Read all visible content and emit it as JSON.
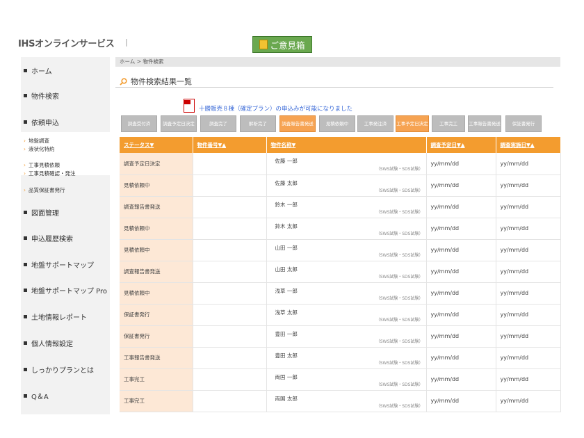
{
  "header": {
    "logo_text": "IHSオンラインサービス",
    "separator": "|",
    "opinion_button": "ご意見箱"
  },
  "sidebar": {
    "items": [
      {
        "label": "ホーム"
      },
      {
        "label": "物件検索"
      },
      {
        "label": "依頼申込"
      },
      {
        "label": "図面管理"
      },
      {
        "label": "申込履歴検索"
      },
      {
        "label": "地盤サポートマップ"
      },
      {
        "label": "地盤サポートマップ Pro"
      },
      {
        "label": "土地情報レポート"
      },
      {
        "label": "個人情報設定"
      },
      {
        "label": "しっかりプランとは"
      },
      {
        "label": "Q＆A"
      }
    ],
    "sub_items": [
      {
        "label": "地盤調査"
      },
      {
        "label": "液状化特約"
      },
      {
        "label": "工事見積依頼"
      },
      {
        "label": "工事見積確認・発注"
      },
      {
        "label": "品質保証書発行"
      }
    ]
  },
  "main": {
    "breadcrumb": "ホーム > 物件検索",
    "title": "物件検索結果一覧",
    "notice": "十勝販売８棟（確定プラン）の申込みが可能になりました",
    "status_buttons": [
      {
        "label": "調査受付済",
        "active": false
      },
      {
        "label": "調査予定日決定",
        "active": false
      },
      {
        "label": "調査完了",
        "active": false
      },
      {
        "label": "解析完了",
        "active": false
      },
      {
        "label": "調査報告書発送",
        "active": true
      },
      {
        "label": "見積依頼中",
        "active": false
      },
      {
        "label": "工事発注済",
        "active": false
      },
      {
        "label": "工事予定日決定",
        "active": true
      },
      {
        "label": "工事完工",
        "active": false
      },
      {
        "label": "工事報告書発送",
        "active": false
      },
      {
        "label": "保証書発行",
        "active": false
      }
    ],
    "table": {
      "headers": [
        "ステータス▼",
        "物件番号▼▲",
        "物件名称▼",
        "調査予定日▼▲",
        "調査実施日▼▲"
      ],
      "rows": [
        {
          "status": "調査予定日決定",
          "number": "",
          "name": "佐藤 一郎",
          "sub": "（SWS試験・SDS試験）",
          "planned": "yy/mm/dd",
          "done": "yy/mm/dd"
        },
        {
          "status": "見積依頼中",
          "number": "",
          "name": "佐藤 太郎",
          "sub": "（SWS試験・SDS試験）",
          "planned": "yy/mm/dd",
          "done": "yy/mm/dd"
        },
        {
          "status": "調査報告書発送",
          "number": "",
          "name": "鈴木 一郎",
          "sub": "（SWS試験・SDS試験）",
          "planned": "yy/mm/dd",
          "done": "yy/mm/dd"
        },
        {
          "status": "見積依頼中",
          "number": "",
          "name": "鈴木 太郎",
          "sub": "（SWS試験・SDS試験）",
          "planned": "yy/mm/dd",
          "done": "yy/mm/dd"
        },
        {
          "status": "見積依頼中",
          "number": "",
          "name": "山田 一郎",
          "sub": "（SWS試験・SDS試験）",
          "planned": "yy/mm/dd",
          "done": "yy/mm/dd"
        },
        {
          "status": "調査報告書発送",
          "number": "",
          "name": "山田 太郎",
          "sub": "（SWS試験・SDS試験）",
          "planned": "yy/mm/dd",
          "done": "yy/mm/dd"
        },
        {
          "status": "見積依頼中",
          "number": "",
          "name": "浅草 一郎",
          "sub": "（SWS試験・SDS試験）",
          "planned": "yy/mm/dd",
          "done": "yy/mm/dd"
        },
        {
          "status": "保証書発行",
          "number": "",
          "name": "浅草 太郎",
          "sub": "（SWS試験・SDS試験）",
          "planned": "yy/mm/dd",
          "done": "yy/mm/dd"
        },
        {
          "status": "保証書発行",
          "number": "",
          "name": "豊田 一郎",
          "sub": "（SWS試験・SDS試験）",
          "planned": "yy/mm/dd",
          "done": "yy/mm/dd"
        },
        {
          "status": "工事報告書発送",
          "number": "",
          "name": "豊田 太郎",
          "sub": "（SWS試験・SDS試験）",
          "planned": "yy/mm/dd",
          "done": "yy/mm/dd"
        },
        {
          "status": "工事完工",
          "number": "",
          "name": "両国 一郎",
          "sub": "（SWS試験・SDS試験）",
          "planned": "yy/mm/dd",
          "done": "yy/mm/dd"
        },
        {
          "status": "工事完工",
          "number": "",
          "name": "両国 太郎",
          "sub": "（SWS試験・SDS試験）",
          "planned": "yy/mm/dd",
          "done": "yy/mm/dd"
        }
      ]
    }
  },
  "colors": {
    "accent": "#f39c2f",
    "status_cell": "#fde8d6",
    "button_gray": "#bdbdbd",
    "button_active": "#f6a352",
    "opinion_green": "#6aa84f",
    "notice_link": "#3a6ad8"
  }
}
